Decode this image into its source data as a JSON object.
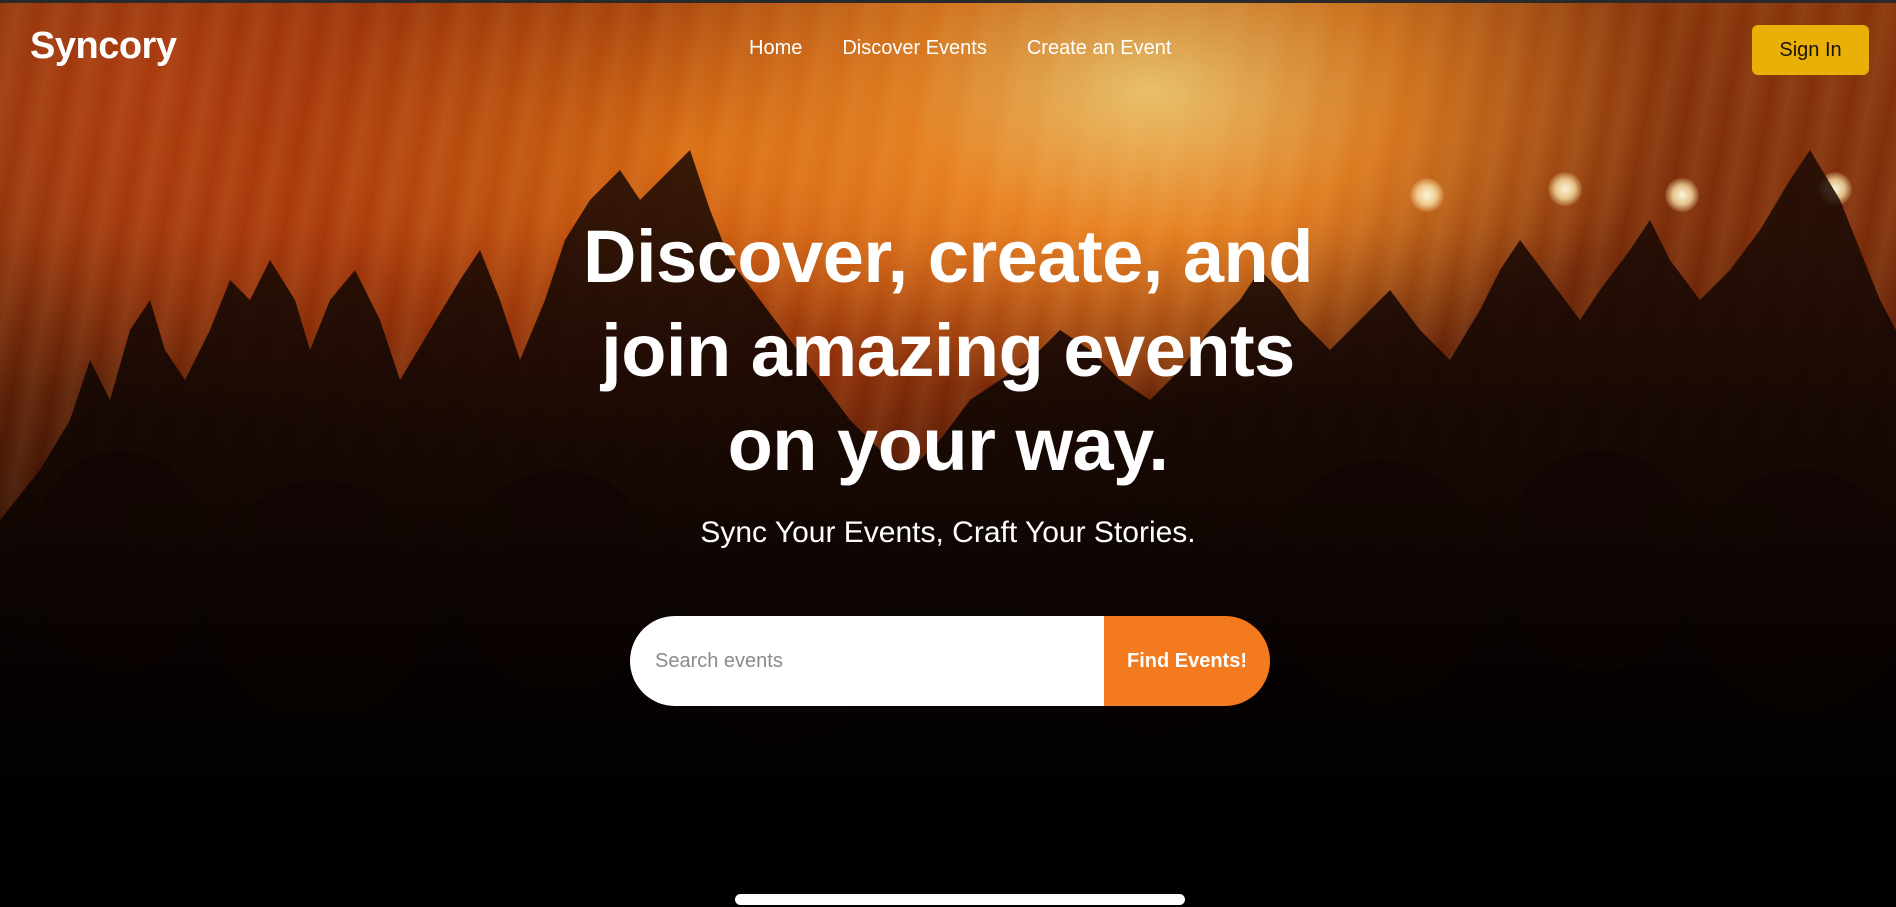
{
  "navbar": {
    "logo": "Syncory",
    "links": [
      "Home",
      "Discover Events",
      "Create an Event"
    ],
    "signin_label": "Sign In"
  },
  "hero": {
    "title": "Discover, create, and join amazing events on your way.",
    "subtitle": "Sync Your Events, Craft Your Stories.",
    "background_icon": "concert-crowd-image"
  },
  "search": {
    "placeholder": "Search events",
    "value": "",
    "button_label": "Find Events!"
  },
  "colors": {
    "accent": "#f47a20",
    "signin": "#e9b008"
  }
}
